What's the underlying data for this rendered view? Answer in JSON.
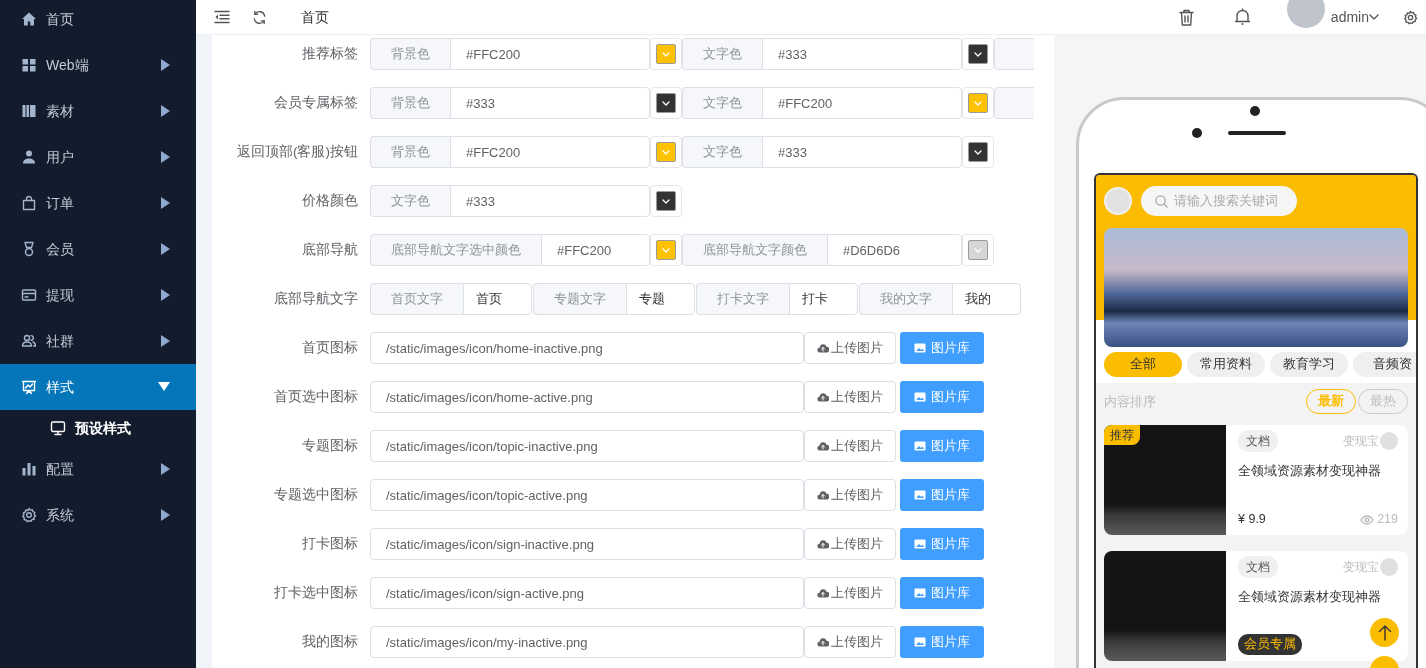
{
  "topbar": {
    "tab": "首页",
    "user": "admin"
  },
  "sidebar": {
    "items": [
      {
        "label": "首页",
        "kind": "link",
        "selected": false
      },
      {
        "label": "Web端",
        "kind": "menu",
        "selected": false,
        "expanded": false
      },
      {
        "label": "素材",
        "kind": "menu",
        "selected": false,
        "expanded": false
      },
      {
        "label": "用户",
        "kind": "menu",
        "selected": false,
        "expanded": false
      },
      {
        "label": "订单",
        "kind": "menu",
        "selected": false,
        "expanded": false
      },
      {
        "label": "会员",
        "kind": "menu",
        "selected": false,
        "expanded": false
      },
      {
        "label": "提现",
        "kind": "menu",
        "selected": false,
        "expanded": false
      },
      {
        "label": "社群",
        "kind": "menu",
        "selected": false,
        "expanded": false
      },
      {
        "label": "样式",
        "kind": "menu",
        "selected": true,
        "expanded": true,
        "children": [
          {
            "label": "预设样式",
            "selected": true
          }
        ]
      },
      {
        "label": "配置",
        "kind": "menu",
        "selected": false,
        "expanded": false
      },
      {
        "label": "系统",
        "kind": "menu",
        "selected": false,
        "expanded": false
      }
    ]
  },
  "form": {
    "rows": [
      {
        "label": "推荐标签",
        "kind": "colors",
        "more": true,
        "fields": [
          {
            "addon": "背景色",
            "value": "#FFC200"
          },
          {
            "addon": "文字色",
            "value": "#333"
          }
        ]
      },
      {
        "label": "会员专属标签",
        "kind": "colors",
        "more": true,
        "fields": [
          {
            "addon": "背景色",
            "value": "#333"
          },
          {
            "addon": "文字色",
            "value": "#FFC200"
          }
        ]
      },
      {
        "label": "返回顶部(客服)按钮",
        "kind": "colors",
        "more": false,
        "fields": [
          {
            "addon": "背景色",
            "value": "#FFC200"
          },
          {
            "addon": "文字色",
            "value": "#333"
          }
        ]
      },
      {
        "label": "价格颜色",
        "kind": "colors",
        "more": false,
        "fields": [
          {
            "addon": "文字色",
            "value": "#333"
          }
        ]
      },
      {
        "label": "底部导航",
        "kind": "colors",
        "more": false,
        "fields": [
          {
            "addon": "底部导航文字选中颜色",
            "value": "#FFC200"
          },
          {
            "addon": "底部导航文字颜色",
            "value": "#D6D6D6"
          }
        ]
      },
      {
        "label": "底部导航文字",
        "kind": "texts",
        "fields": [
          {
            "addon": "首页文字",
            "value": "首页"
          },
          {
            "addon": "专题文字",
            "value": "专题"
          },
          {
            "addon": "打卡文字",
            "value": "打卡"
          },
          {
            "addon": "我的文字",
            "value": "我的"
          }
        ]
      },
      {
        "label": "首页图标",
        "kind": "image",
        "value": "/static/images/icon/home-inactive.png",
        "upload": "上传图片",
        "library": "图片库"
      },
      {
        "label": "首页选中图标",
        "kind": "image",
        "value": "/static/images/icon/home-active.png",
        "upload": "上传图片",
        "library": "图片库"
      },
      {
        "label": "专题图标",
        "kind": "image",
        "value": "/static/images/icon/topic-inactive.png",
        "upload": "上传图片",
        "library": "图片库"
      },
      {
        "label": "专题选中图标",
        "kind": "image",
        "value": "/static/images/icon/topic-active.png",
        "upload": "上传图片",
        "library": "图片库"
      },
      {
        "label": "打卡图标",
        "kind": "image",
        "value": "/static/images/icon/sign-inactive.png",
        "upload": "上传图片",
        "library": "图片库"
      },
      {
        "label": "打卡选中图标",
        "kind": "image",
        "value": "/static/images/icon/sign-active.png",
        "upload": "上传图片",
        "library": "图片库"
      },
      {
        "label": "我的图标",
        "kind": "image",
        "value": "/static/images/icon/my-inactive.png",
        "upload": "上传图片",
        "library": "图片库"
      }
    ]
  },
  "preview": {
    "search_placeholder": "请输入搜索关键词",
    "categories": [
      {
        "label": "全部",
        "selected": true
      },
      {
        "label": "常用资料",
        "selected": false
      },
      {
        "label": "教育学习",
        "selected": false
      },
      {
        "label": "音频资",
        "selected": false
      }
    ],
    "sort_label": "内容排序",
    "sort_options": [
      {
        "label": "最新",
        "selected": true
      },
      {
        "label": "最热",
        "selected": false
      }
    ],
    "items": [
      {
        "badge": "推荐",
        "tag": "文档",
        "author": "变现宝",
        "title": "全领域资源素材变现神器",
        "price": "¥ 9.9",
        "views": "219"
      },
      {
        "tag": "文档",
        "author": "变现宝",
        "title": "全领域资源素材变现神器",
        "member_badge": "会员专属"
      }
    ]
  }
}
